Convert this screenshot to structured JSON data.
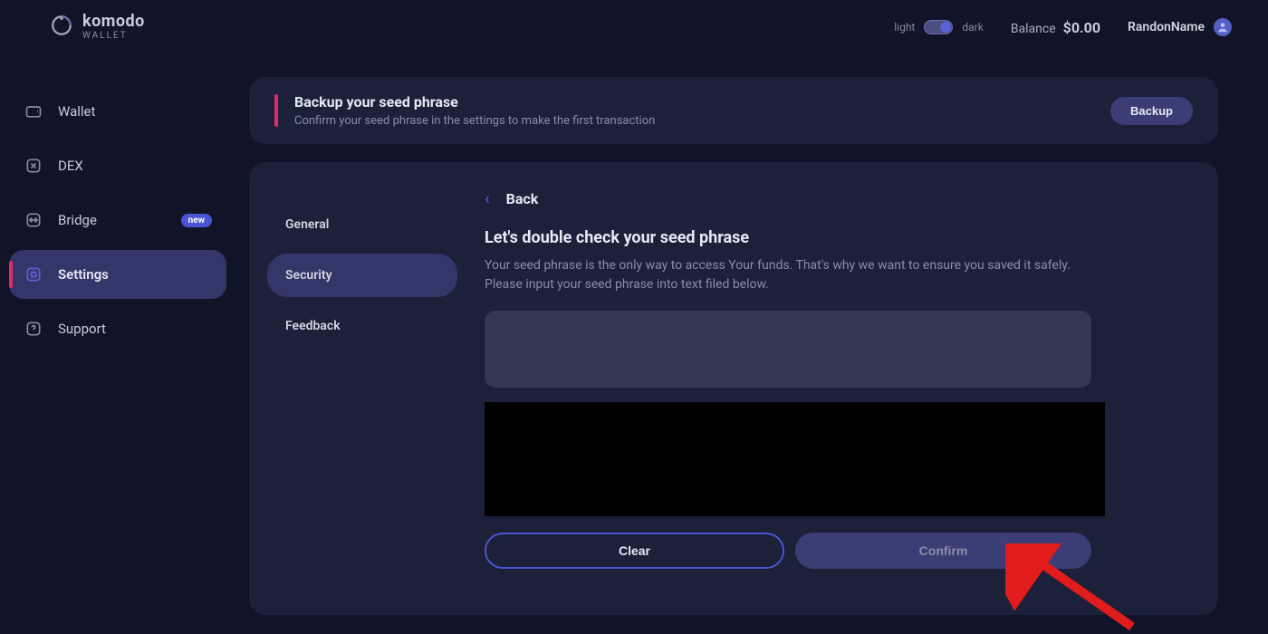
{
  "brand": {
    "name": "komodo",
    "sub": "WALLET"
  },
  "theme": {
    "light": "light",
    "dark": "dark"
  },
  "balance": {
    "label": "Balance",
    "value": "$0.00"
  },
  "user": {
    "name": "RandonName"
  },
  "sidebar": {
    "items": [
      {
        "label": "Wallet"
      },
      {
        "label": "DEX"
      },
      {
        "label": "Bridge",
        "badge": "new"
      },
      {
        "label": "Settings"
      },
      {
        "label": "Support"
      }
    ]
  },
  "banner": {
    "title": "Backup your seed phrase",
    "subtitle": "Confirm your seed phrase in the settings to make the first transaction",
    "button": "Backup"
  },
  "tabs": [
    {
      "label": "General"
    },
    {
      "label": "Security"
    },
    {
      "label": "Feedback"
    }
  ],
  "panel": {
    "back": "Back",
    "title": "Let's double check your seed phrase",
    "desc": "Your seed phrase is the only way to access Your funds. That's why we want to ensure you saved it safely. Please input your seed phrase into text filed below.",
    "clear": "Clear",
    "confirm": "Confirm"
  }
}
